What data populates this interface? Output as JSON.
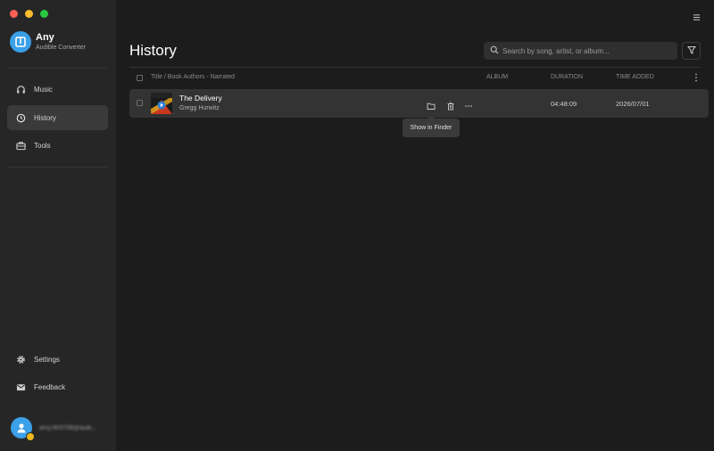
{
  "app": {
    "name": "Any",
    "subtitle": "Audible Converter"
  },
  "sidebar": {
    "items": [
      {
        "label": "Music",
        "icon": "headphones-icon"
      },
      {
        "label": "History",
        "icon": "clock-icon",
        "active": true
      },
      {
        "label": "Tools",
        "icon": "toolbox-icon"
      }
    ],
    "bottom": [
      {
        "label": "Settings",
        "icon": "gear-icon"
      },
      {
        "label": "Feedback",
        "icon": "mail-icon"
      }
    ],
    "user": {
      "email": "amy.903708@audi..."
    }
  },
  "main": {
    "title": "History",
    "search": {
      "placeholder": "Search by song, artist, or album..."
    },
    "table": {
      "headers": {
        "title": "Title / Book Authors - Narrated",
        "album": "ALBUM",
        "duration": "DURATION",
        "time_added": "TIME ADDED"
      },
      "rows": [
        {
          "title": "The Delivery",
          "author": "Gregg Hurwitz",
          "album": "",
          "duration": "04:48:09",
          "time_added": "2026/07/01"
        }
      ]
    },
    "tooltip": "Show in Finder"
  },
  "colors": {
    "accent": "#3aa0e8",
    "background": "#1c1c1c",
    "sidebar": "#262626",
    "row": "#333333"
  }
}
